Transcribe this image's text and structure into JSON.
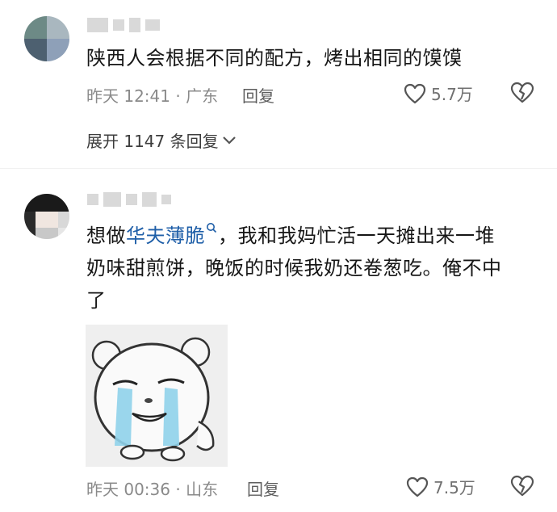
{
  "comments": [
    {
      "text": "陕西人会根据不同的配方，烤出相同的馍馍",
      "time": "昨天 12:41 · 广东",
      "reply_label": "回复",
      "like_count": "5.7万",
      "expand_label": "展开 1147 条回复"
    },
    {
      "text_link": "华夫薄脆",
      "text_pre": "想做",
      "text_post": "，我和我妈忙活一天摊出来一堆",
      "text_line2": "奶味甜煎饼，晚饭的时候我奶还卷葱吃。俺不中",
      "text_line3": "了",
      "time": "昨天 00:36 · 山东",
      "reply_label": "回复",
      "like_count": "7.5万"
    }
  ],
  "icons": {
    "like": "heart-outline-icon",
    "dislike": "broken-heart-icon",
    "expand": "chevron-down-icon",
    "search": "search-icon"
  },
  "colors": {
    "link": "#1f5fa8",
    "meta": "#8a8a8a"
  }
}
